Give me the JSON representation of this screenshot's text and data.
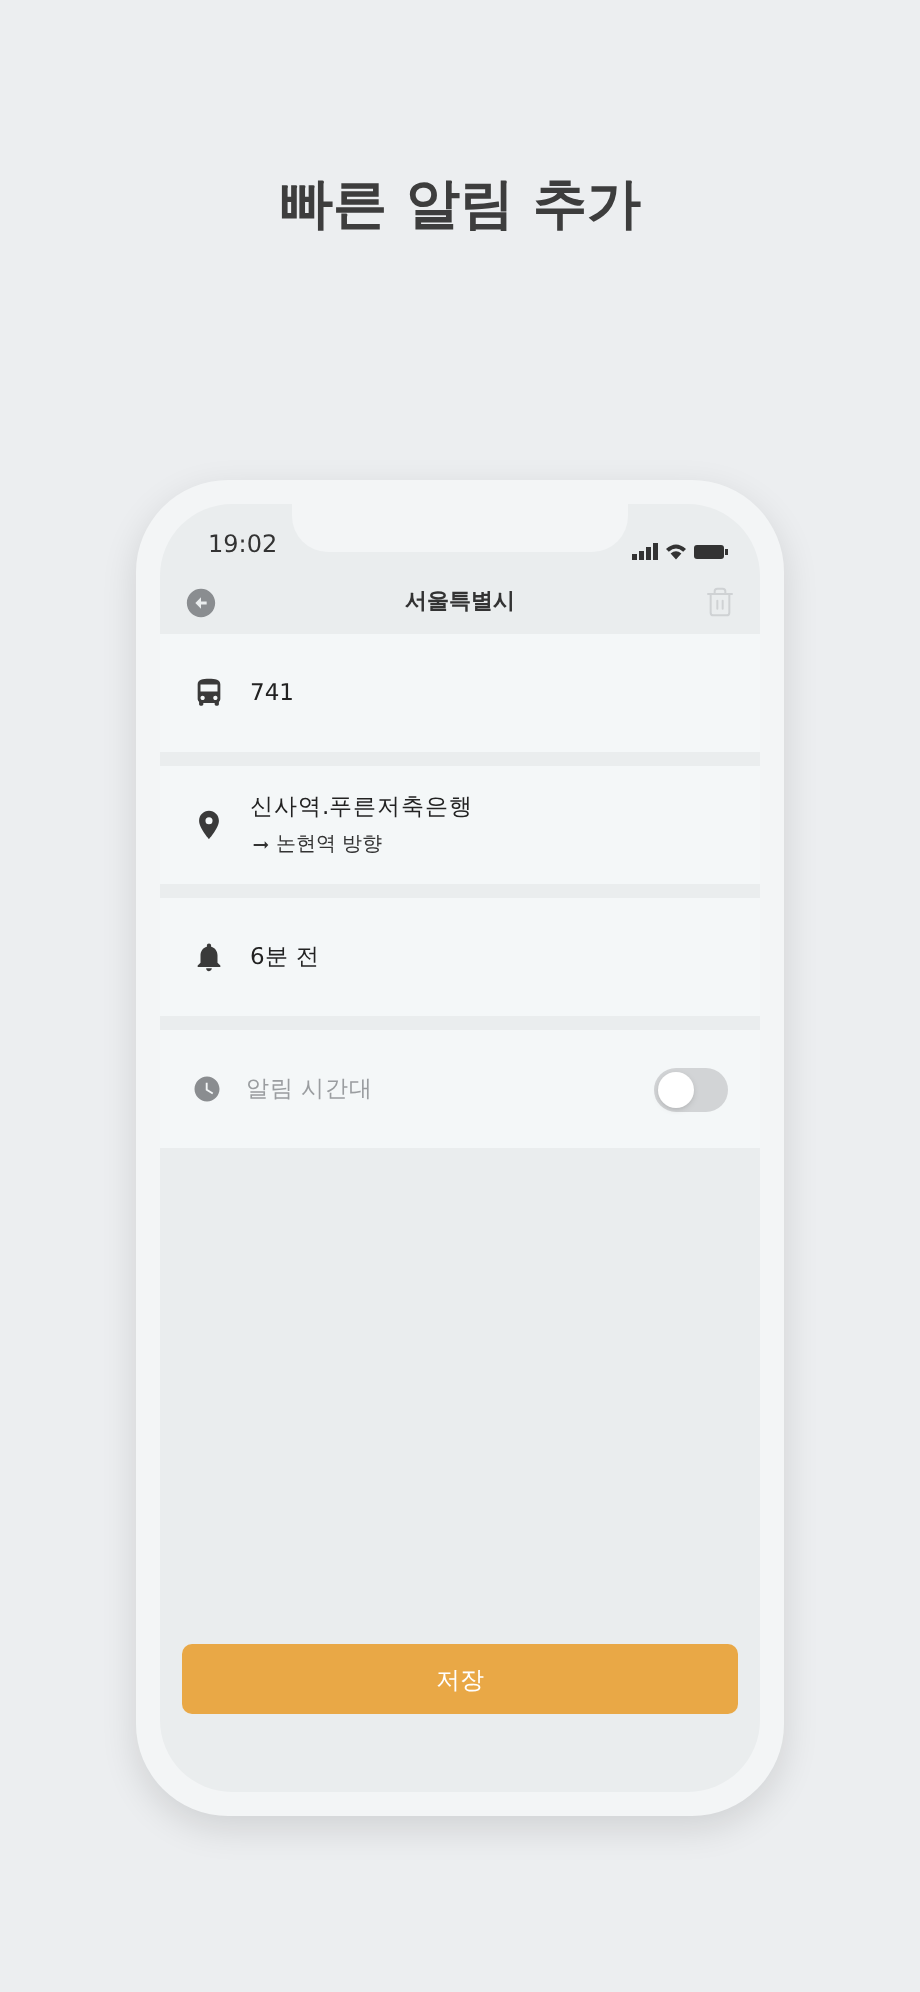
{
  "headline": "빠른 알림 추가",
  "status_bar": {
    "time": "19:02"
  },
  "nav": {
    "title": "서울특별시",
    "delete_disabled": true
  },
  "rows": [
    {
      "kind": "bus",
      "text": "741"
    },
    {
      "kind": "stop",
      "text": "신사역.푸른저축은행",
      "subtext": "논현역 방향"
    },
    {
      "kind": "alarm",
      "text": "6분 전"
    },
    {
      "kind": "time_range",
      "text": "알림 시간대",
      "on": false
    }
  ],
  "save_button": {
    "label": "저장"
  }
}
